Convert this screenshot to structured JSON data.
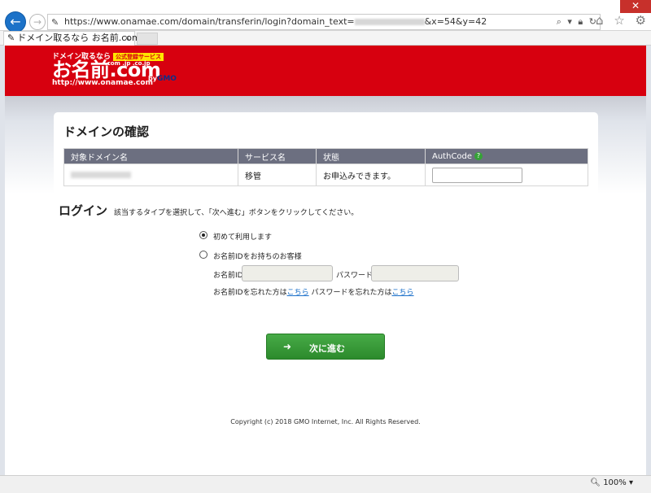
{
  "browser": {
    "url_prefix": "https://www.onamae.com/domain/transferin/login?domain_text=",
    "url_suffix": "&x=54&y=42",
    "tab_title": "ドメイン取るなら お名前.com",
    "tab_close": "×",
    "zoom": "100%",
    "zoom_caret": "▾"
  },
  "logo": {
    "tagline": "ドメイン取るなら",
    "badge": "公式登録サービス",
    "main": "お名前.com",
    "sub": ".com .jp .co.jp",
    "url": "http://www.onamae.com",
    "gmo_prefix": "by",
    "gmo": "GMO"
  },
  "domain_confirm": {
    "title": "ドメインの確認",
    "headers": [
      "対象ドメイン名",
      "サービス名",
      "状態",
      "AuthCode"
    ],
    "row": {
      "service": "移管",
      "status": "お申込みできます。",
      "authcode_value": ""
    }
  },
  "login": {
    "title": "ログイン",
    "description": "該当するタイプを選択して、「次へ進む」ボタンをクリックしてください。",
    "option_new": "初めて利用します",
    "option_existing": "お名前IDをお持ちのお客様",
    "id_label": "お名前ID",
    "id_value": "",
    "password_label": "パスワード",
    "password_value": "",
    "forgot_id_prefix": "お名前IDを忘れた方は",
    "forgot_id_link": "こちら",
    "forgot_pw_prefix": "パスワードを忘れた方は",
    "forgot_pw_link": "こちら",
    "selected_option": "new"
  },
  "next_button": "次に進む",
  "copyright": "Copyright (c) 2018 GMO Internet, Inc. All Rights Reserved.",
  "icons": {
    "back": "back-arrow-icon",
    "forward": "forward-arrow-icon",
    "help": "help-question-icon",
    "next": "right-arrow-icon"
  }
}
